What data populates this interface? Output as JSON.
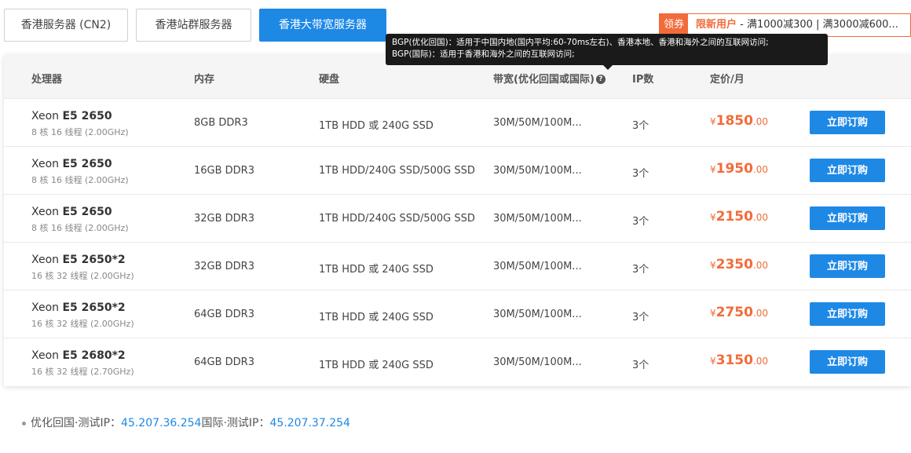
{
  "tabs": [
    {
      "label": "香港服务器 (CN2)"
    },
    {
      "label": "香港站群服务器"
    },
    {
      "label": "香港大带宽服务器"
    }
  ],
  "promo": {
    "tag": "领券",
    "highlight": "限新用户",
    "text": " - 满1000减300 | 满3000减600..."
  },
  "tooltip": {
    "line1": "BGP(优化回国)：适用于中国内地(国内平均:60-70ms左右)、香港本地、香港和海外之间的互联网访问;",
    "line2": "BGP(国际)：适用于香港和海外之间的互联网访问;"
  },
  "table": {
    "headers": {
      "cpu": "处理器",
      "memory": "内存",
      "disk": "硬盘",
      "bandwidth": "带宽(优化回国或国际)",
      "ip": "IP数",
      "price": "定价/月"
    },
    "rows": [
      {
        "cpu_prefix": "Xeon ",
        "cpu_model": "E5 2650",
        "cpu_sub": "8 核 16 线程 (2.00GHz)",
        "memory": "8GB DDR3",
        "disk": "1TB HDD 或 240G SSD",
        "bandwidth": "30M/50M/100M...",
        "ip": "3个",
        "currency": "¥",
        "price_int": "1850",
        "price_dec": ".00",
        "button": "立即订购"
      },
      {
        "cpu_prefix": "Xeon ",
        "cpu_model": "E5 2650",
        "cpu_sub": "8 核 16 线程 (2.00GHz)",
        "memory": "16GB DDR3",
        "disk": "1TB HDD/240G SSD/500G SSD",
        "bandwidth": "30M/50M/100M...",
        "ip": "3个",
        "currency": "¥",
        "price_int": "1950",
        "price_dec": ".00",
        "button": "立即订购"
      },
      {
        "cpu_prefix": "Xeon ",
        "cpu_model": "E5 2650",
        "cpu_sub": "8 核 16 线程 (2.00GHz)",
        "memory": "32GB DDR3",
        "disk": "1TB HDD/240G SSD/500G SSD",
        "bandwidth": "30M/50M/100M...",
        "ip": "3个",
        "currency": "¥",
        "price_int": "2150",
        "price_dec": ".00",
        "button": "立即订购"
      },
      {
        "cpu_prefix": "Xeon ",
        "cpu_model": "E5 2650*2",
        "cpu_sub": "16 核 32 线程 (2.00GHz)",
        "memory": "32GB DDR3",
        "disk": "1TB HDD 或 240G SSD",
        "bandwidth": "30M/50M/100M...",
        "ip": "3个",
        "currency": "¥",
        "price_int": "2350",
        "price_dec": ".00",
        "button": "立即订购"
      },
      {
        "cpu_prefix": "Xeon ",
        "cpu_model": "E5 2650*2",
        "cpu_sub": "16 核 32 线程 (2.00GHz)",
        "memory": "64GB DDR3",
        "disk": "1TB HDD 或 240G SSD",
        "bandwidth": "30M/50M/100M...",
        "ip": "3个",
        "currency": "¥",
        "price_int": "2750",
        "price_dec": ".00",
        "button": "立即订购"
      },
      {
        "cpu_prefix": "Xeon ",
        "cpu_model": "E5 2680*2",
        "cpu_sub": "16 核 32 线程 (2.70GHz)",
        "memory": "64GB DDR3",
        "disk": "1TB HDD 或 240G SSD",
        "bandwidth": "30M/50M/100M...",
        "ip": "3个",
        "currency": "¥",
        "price_int": "3150",
        "price_dec": ".00",
        "button": "立即订购"
      }
    ]
  },
  "test_ip": {
    "label1": "优化回国·测试IP：",
    "ip1": "45.207.36.254",
    "label2": "国际·测试IP：",
    "ip2": "45.207.37.254"
  },
  "colors": {
    "accent": "#1e88e5",
    "price": "#f26b3a"
  },
  "icons": {
    "help": "question-circle-icon",
    "bullet": "bullet-dot-icon"
  }
}
